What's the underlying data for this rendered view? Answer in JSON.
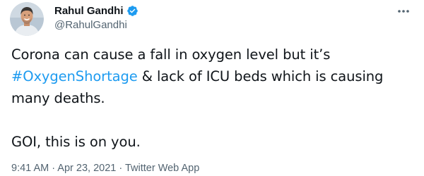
{
  "author": {
    "name": "Rahul Gandhi",
    "handle": "@RahulGandhi",
    "verified": true,
    "avatar_icon": "profile-photo"
  },
  "tweet": {
    "text_before_hashtag": "Corona can cause a fall in oxygen level but it’s",
    "hashtag": "#OxygenShortage",
    "text_after_hashtag": " & lack of ICU beds which is causing many deaths.",
    "second_paragraph": "GOI, this is on you."
  },
  "meta": {
    "time": "9:41 AM",
    "separator": " · ",
    "date": "Apr 23, 2021",
    "source": "Twitter Web App"
  },
  "colors": {
    "accent": "#1d9bf0",
    "text": "#0f1419",
    "secondary": "#536471"
  }
}
